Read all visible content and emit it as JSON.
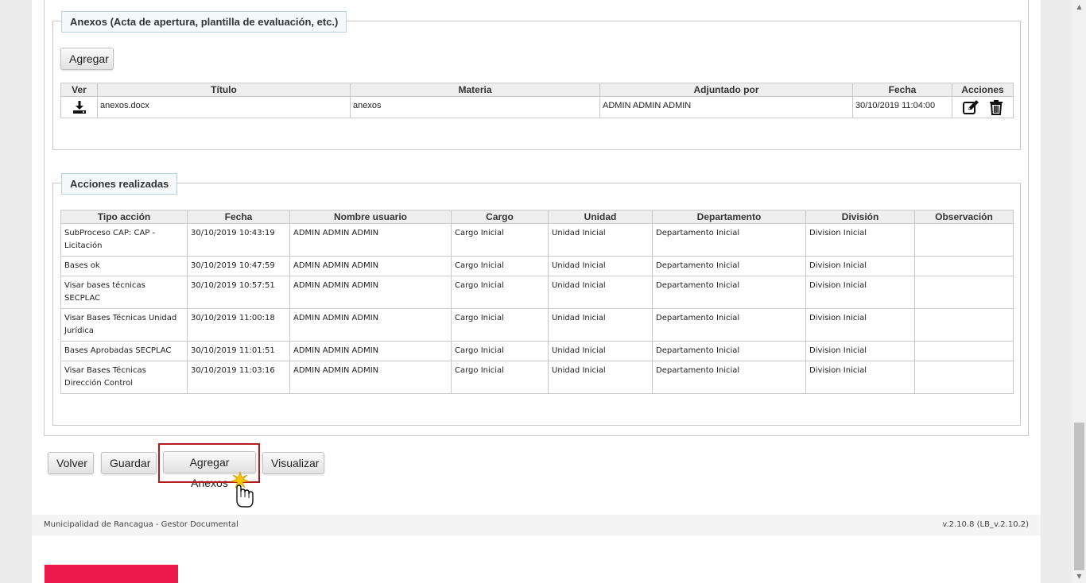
{
  "annexes": {
    "legend": "Anexos (Acta de apertura, plantilla de evaluación, etc.)",
    "add_label": "Agregar",
    "columns": [
      "Ver",
      "Título",
      "Materia",
      "Adjuntado por",
      "Fecha",
      "Acciones"
    ],
    "rows": [
      {
        "view_icon": "download-icon",
        "title": "anexos.docx",
        "subject": "anexos",
        "attached_by": "ADMIN ADMIN ADMIN",
        "date": "30/10/2019 11:04:00",
        "action_icons": [
          "edit-icon",
          "trash-icon"
        ]
      }
    ]
  },
  "actions": {
    "legend": "Acciones realizadas",
    "columns": [
      "Tipo acción",
      "Fecha",
      "Nombre usuario",
      "Cargo",
      "Unidad",
      "Departamento",
      "División",
      "Observación"
    ],
    "rows": [
      {
        "type": "SubProceso CAP: CAP - Licitación",
        "date": "30/10/2019 10:43:19",
        "user": "ADMIN ADMIN ADMIN",
        "cargo": "Cargo Inicial",
        "unidad": "Unidad Inicial",
        "departamento": "Departamento Inicial",
        "division": "Division Inicial",
        "observacion": ""
      },
      {
        "type": "Bases ok",
        "date": "30/10/2019 10:47:59",
        "user": "ADMIN ADMIN ADMIN",
        "cargo": "Cargo Inicial",
        "unidad": "Unidad Inicial",
        "departamento": "Departamento Inicial",
        "division": "Division Inicial",
        "observacion": ""
      },
      {
        "type": "Visar bases técnicas SECPLAC",
        "date": "30/10/2019 10:57:51",
        "user": "ADMIN ADMIN ADMIN",
        "cargo": "Cargo Inicial",
        "unidad": "Unidad Inicial",
        "departamento": "Departamento Inicial",
        "division": "Division Inicial",
        "observacion": ""
      },
      {
        "type": "Visar Bases Técnicas Unidad Jurídica",
        "date": "30/10/2019 11:00:18",
        "user": "ADMIN ADMIN ADMIN",
        "cargo": "Cargo Inicial",
        "unidad": "Unidad Inicial",
        "departamento": "Departamento Inicial",
        "division": "Division Inicial",
        "observacion": ""
      },
      {
        "type": "Bases Aprobadas SECPLAC",
        "date": "30/10/2019 11:01:51",
        "user": "ADMIN ADMIN ADMIN",
        "cargo": "Cargo Inicial",
        "unidad": "Unidad Inicial",
        "departamento": "Departamento Inicial",
        "division": "Division Inicial",
        "observacion": ""
      },
      {
        "type": "Visar Bases Técnicas Dirección Control",
        "date": "30/10/2019 11:03:16",
        "user": "ADMIN ADMIN ADMIN",
        "cargo": "Cargo Inicial",
        "unidad": "Unidad Inicial",
        "departamento": "Departamento Inicial",
        "division": "Division Inicial",
        "observacion": ""
      }
    ]
  },
  "bottom_buttons": {
    "back": "Volver",
    "save": "Guardar",
    "add_annexes": "Agregar Anexos",
    "preview": "Visualizar"
  },
  "footer": {
    "left": "Municipalidad de Rancagua - Gestor Documental",
    "right": "v.2.10.8 (LB_v.2.10.2)"
  },
  "colors": {
    "brand": "#ec1a4a",
    "highlight": "#b51b1b"
  }
}
